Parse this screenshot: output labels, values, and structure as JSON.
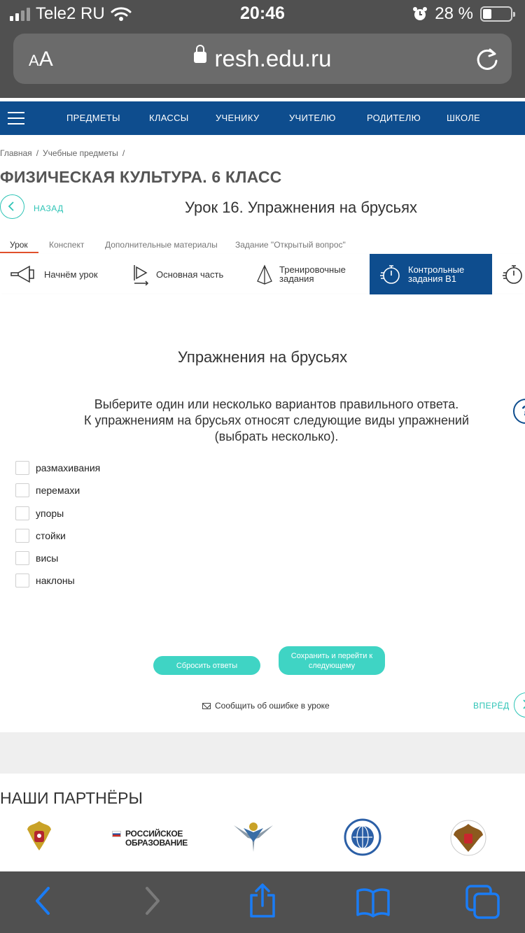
{
  "status_bar": {
    "carrier": "Tele2 RU",
    "time": "20:46",
    "battery_percent": "28 %",
    "battery_level": 0.28
  },
  "browser": {
    "text_size_small": "A",
    "text_size_large": "A",
    "url": "resh.edu.ru"
  },
  "nav": {
    "items": [
      "ПРЕДМЕТЫ",
      "КЛАССЫ",
      "УЧЕНИКУ",
      "УЧИТЕЛЮ",
      "РОДИТЕЛЮ",
      "ШКОЛЕ"
    ]
  },
  "breadcrumb": [
    "Главная",
    "/",
    "Учебные предметы",
    "/"
  ],
  "page": {
    "subject_title": "ФИЗИЧЕСКАЯ КУЛЬТУРА. 6 КЛАСС",
    "back_label": "НАЗАД",
    "lesson_title": "Урок 16. Упражнения на брусьях"
  },
  "tabs": [
    "Урок",
    "Конспект",
    "Дополнительные материалы",
    "Задание \"Открытый вопрос\""
  ],
  "steps": [
    {
      "line1": "Начнём урок",
      "line2": ""
    },
    {
      "line1": "Основная часть",
      "line2": ""
    },
    {
      "line1": "Тренировочные",
      "line2": "задания"
    },
    {
      "line1": "Контрольные",
      "line2": "задания В1"
    }
  ],
  "task": {
    "title": "Упражнения на брусьях",
    "instruction_line1": "Выберите один или несколько вариантов правильного ответа.",
    "instruction_line2": "К упражнениям на брусьях относят следующие виды упражнений",
    "instruction_line3": "(выбрать несколько).",
    "help_symbol": "?",
    "options": [
      "размахивания",
      "перемахи",
      "упоры",
      "стойки",
      "висы",
      "наклоны"
    ],
    "reset_label": "Сбросить ответы",
    "save_label_line1": "Сохранить и перейти к",
    "save_label_line2": "следующему",
    "report_label": "Сообщить об ошибке в уроке",
    "forward_label": "ВПЕРЁД"
  },
  "partners": {
    "title": "НАШИ ПАРТНЁРЫ",
    "logo2_line1": "РОССИЙСКОЕ",
    "logo2_line2": "ОБРАЗОВАНИЕ"
  },
  "colors": {
    "nav_blue": "#0e4d8e",
    "accent_teal": "#2ec4b6",
    "button_teal": "#3fd4c4",
    "tab_underline": "#e0502c",
    "safari_blue": "#1a7cf5"
  }
}
